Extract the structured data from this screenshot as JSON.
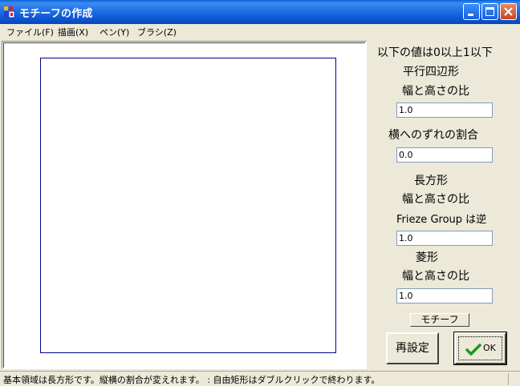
{
  "window": {
    "title": "モチーフの作成",
    "accent_color": "#0a5fd8"
  },
  "menu": {
    "items": [
      {
        "label": "ファイル(F)"
      },
      {
        "label": "描画(X)"
      },
      {
        "label": "ペン(Y)"
      },
      {
        "label": "ブラシ(Z)"
      }
    ]
  },
  "panel": {
    "range_note": "以下の値は0以上1以下",
    "parallelogram_title": "平行四辺形",
    "parallelogram_ratio_label": "幅と高さの比",
    "parallelogram_ratio_value": "1.0",
    "shift_ratio_label": "横へのずれの割合",
    "shift_ratio_value": "0.0",
    "rectangle_title": "長方形",
    "rectangle_ratio_label": "幅と高さの比",
    "frieze_note": "Frieze Group は逆",
    "rectangle_ratio_value": "1.0",
    "rhombus_title": "菱形",
    "rhombus_ratio_label": "幅と高さの比",
    "rhombus_ratio_value": "1.0",
    "motif_button": "モチーフ",
    "reset_button": "再設定",
    "ok_button": "OK"
  },
  "status": {
    "text": "基本領域は長方形です。縦横の割合が変えれます。 : 自由矩形はダブルクリックで終わります。"
  }
}
